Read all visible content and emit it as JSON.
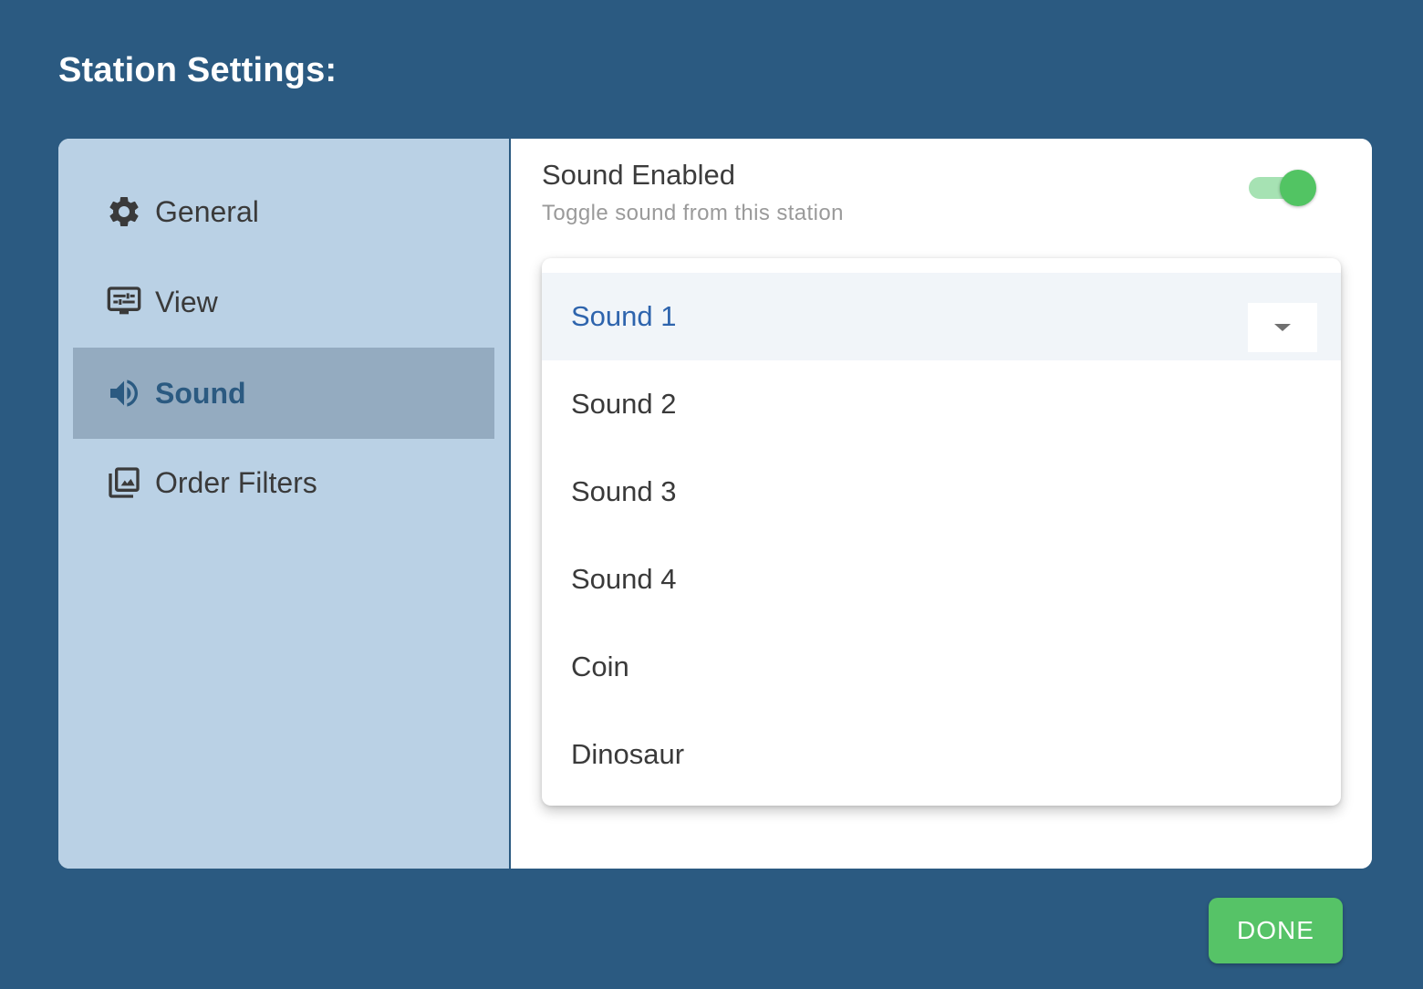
{
  "header": {
    "title": "Station Settings:"
  },
  "sidebar": {
    "items": [
      {
        "label": "General",
        "icon": "gear-icon",
        "active": false
      },
      {
        "label": "View",
        "icon": "tune-icon",
        "active": false
      },
      {
        "label": "Sound",
        "icon": "volume-icon",
        "active": true
      },
      {
        "label": "Order Filters",
        "icon": "image-library-icon",
        "active": false
      }
    ]
  },
  "sound_setting": {
    "title": "Sound Enabled",
    "subtitle": "Toggle sound from this station",
    "enabled": true
  },
  "sound_dropdown": {
    "selected": "Sound 1",
    "options": [
      "Sound 1",
      "Sound 2",
      "Sound 3",
      "Sound 4",
      "Coin",
      "Dinosaur"
    ]
  },
  "footer": {
    "done_label": "DONE"
  },
  "colors": {
    "background": "#2b5a81",
    "sidebar": "#bad1e5",
    "sidebar_active": "#94abc0",
    "accent_green": "#56c367",
    "selected_text": "#2e64ad"
  }
}
